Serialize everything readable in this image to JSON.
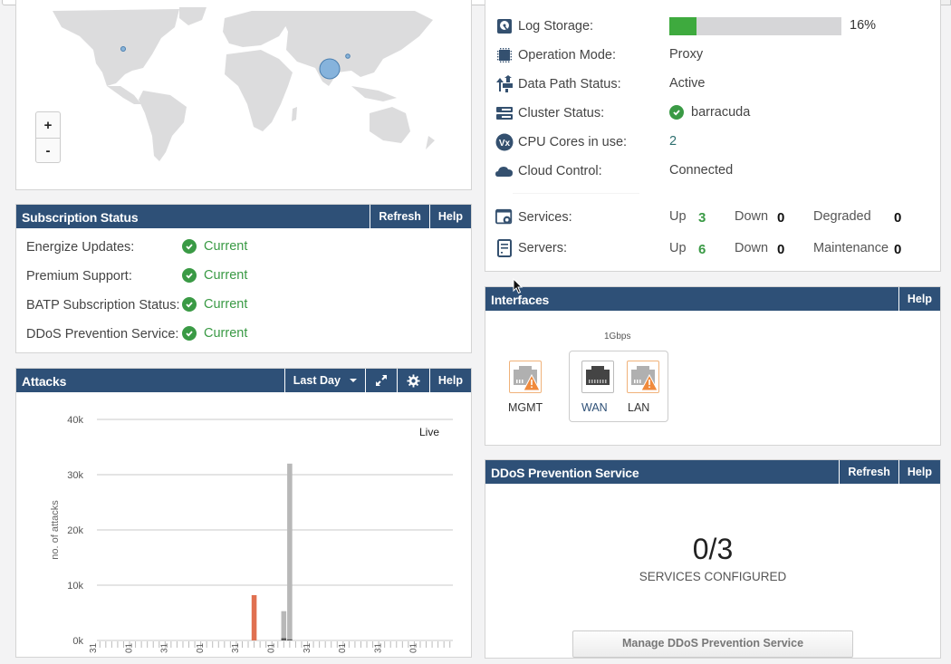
{
  "map": {
    "zoom_in_label": "+",
    "zoom_out_label": "-",
    "markers": [
      {
        "region": "North America",
        "size": "small"
      },
      {
        "region": "India",
        "size": "large"
      },
      {
        "region": "China",
        "size": "small"
      }
    ]
  },
  "system": {
    "rows": [
      {
        "icon": "hard-disk-icon",
        "label": "Log Storage:"
      },
      {
        "icon": "cpu-chip-icon",
        "label": "Operation Mode:",
        "value": "Proxy"
      },
      {
        "icon": "data-path-icon",
        "label": "Data Path Status:",
        "value": "Active"
      },
      {
        "icon": "cluster-icon",
        "label": "Cluster Status:",
        "value": "barracuda"
      },
      {
        "icon": "vx-icon",
        "label": "CPU Cores in use:",
        "value": "2"
      },
      {
        "icon": "cloud-icon",
        "label": "Cloud Control:",
        "value": "Connected"
      }
    ],
    "log_storage_percent": 16,
    "log_storage_label": "16%",
    "services": {
      "label": "Services:",
      "up_label": "Up",
      "up": "3",
      "down_label": "Down",
      "down": "0",
      "third_label": "Degraded",
      "third": "0"
    },
    "servers": {
      "label": "Servers:",
      "up_label": "Up",
      "up": "6",
      "down_label": "Down",
      "down": "0",
      "third_label": "Maintenance",
      "third": "0"
    }
  },
  "subscription": {
    "title": "Subscription Status",
    "refresh": "Refresh",
    "help": "Help",
    "items": [
      {
        "label": "Energize Updates:",
        "status": "Current"
      },
      {
        "label": "Premium Support:",
        "status": "Current"
      },
      {
        "label": "BATP Subscription Status:",
        "status": "Current"
      },
      {
        "label": "DDoS Prevention Service:",
        "status": "Current"
      }
    ]
  },
  "attacks": {
    "title": "Attacks",
    "range": "Last Day",
    "help": "Help",
    "live_label": "Live"
  },
  "chart_data": {
    "type": "bar",
    "title": "Attacks",
    "xlabel": "",
    "ylabel": "no. of attacks",
    "ylim": [
      0,
      40000
    ],
    "yticks": [
      0,
      10000,
      20000,
      30000,
      40000
    ],
    "ytick_labels": [
      "0k",
      "10k",
      "20k",
      "30k",
      "40k"
    ],
    "xtick_labels": [
      "31",
      "01",
      "31",
      "01",
      "31",
      "01",
      "31",
      "01",
      "31",
      "01"
    ],
    "grid": true,
    "legend": "Live",
    "legend_position": "top-right",
    "num_slots": 60,
    "series": [
      {
        "name": "orange",
        "color": "#e07050",
        "points": [
          {
            "slot": 26,
            "value": 8200
          }
        ]
      },
      {
        "name": "gray",
        "color": "#b8b8b8",
        "points": [
          {
            "slot": 31,
            "value": 5300
          },
          {
            "slot": 32,
            "value": 32000
          }
        ]
      },
      {
        "name": "dark",
        "color": "#555555",
        "points": [
          {
            "slot": 31,
            "value": 400
          },
          {
            "slot": 32,
            "value": 200
          }
        ]
      }
    ]
  },
  "interfaces": {
    "title": "Interfaces",
    "help": "Help",
    "speed": "1Gbps",
    "ports": [
      {
        "name": "MGMT",
        "status": "warning"
      },
      {
        "name": "WAN",
        "status": "connected"
      },
      {
        "name": "LAN",
        "status": "warning"
      }
    ]
  },
  "ddos": {
    "title": "DDoS Prevention Service",
    "refresh": "Refresh",
    "help": "Help",
    "count": "0/3",
    "subtitle": "SERVICES CONFIGURED",
    "manage_button": "Manage DDoS Prevention Service"
  },
  "colors": {
    "header": "#2e5077",
    "success": "#3a9a45",
    "warning": "#f08a3c"
  }
}
